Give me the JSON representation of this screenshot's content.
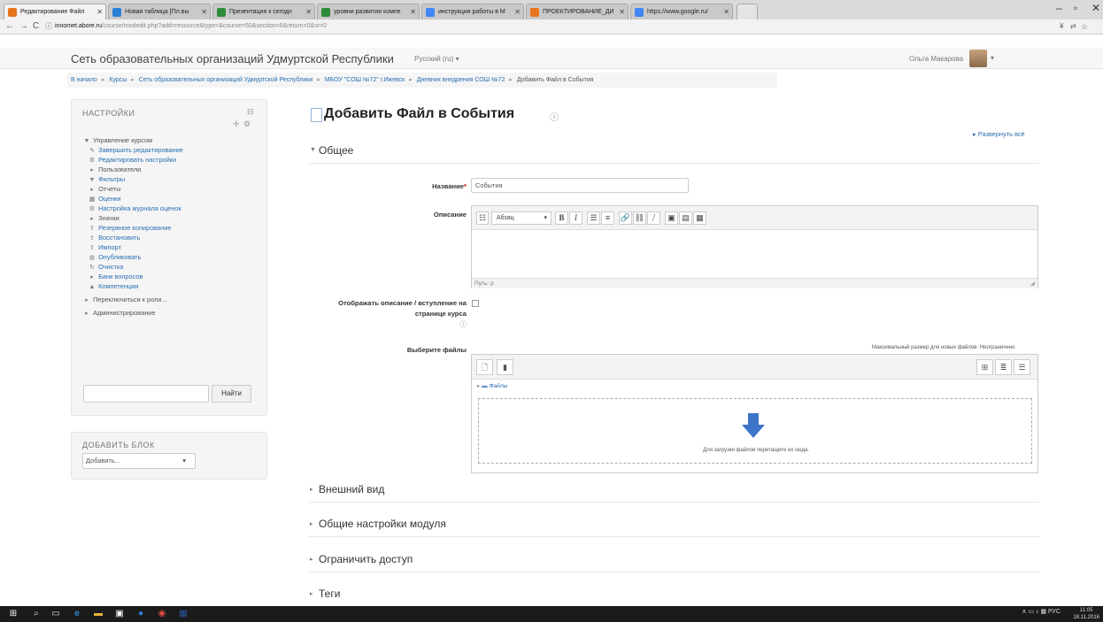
{
  "browser": {
    "tabs": [
      {
        "label": "Редактирование Файл",
        "active": true,
        "icon": "moodle-icon",
        "color": "#e8741c"
      },
      {
        "label": "Новая таблица [Пл.вы",
        "icon": "sheets-icon",
        "color": "#2a7fd4"
      },
      {
        "label": "Презентация к сегодн",
        "icon": "slides-icon",
        "color": "#2e8b3a"
      },
      {
        "label": "уровни развития компе",
        "icon": "sheets-icon",
        "color": "#2e8b3a"
      },
      {
        "label": "инструкция работы в М",
        "icon": "google-icon",
        "color": "#4285f4"
      },
      {
        "label": "ПРОЕКТИРОВАНИЕ_ДИ",
        "icon": "moodle-icon",
        "color": "#e8741c"
      },
      {
        "label": "https://www.google.ru/",
        "icon": "google-icon",
        "color": "#4285f4"
      }
    ],
    "url_host": "innomet.abore.ru",
    "url_path": "/course/modedit.php?add=resource&type=&course=50&section=6&return=0&sr=0",
    "window_controls": [
      "–",
      "▫",
      "✕"
    ]
  },
  "header": {
    "site_name": "Сеть образовательных организаций Удмуртской Республики",
    "language": "Русский (ru) ▾",
    "user_name": "Ольга Макарова",
    "user_caret": "▾"
  },
  "breadcrumb": [
    "В начало",
    "Курсы",
    "Сеть образовательных организаций Удмуртской Республики",
    "МБОУ \"СОШ №72\" г.Ижевск",
    "Дневник внедрения СОШ №72",
    "Добавить Файл в События"
  ],
  "settings_block": {
    "title": "НАСТРОЙКИ",
    "items": [
      {
        "label": "Управление курсом",
        "icon": "caret-down-icon",
        "cls": "root"
      },
      {
        "label": "Завершить редактирование",
        "icon": "pencil-icon",
        "cls": "sub"
      },
      {
        "label": "Редактировать настройки",
        "icon": "gear-icon",
        "cls": "sub"
      },
      {
        "label": "Пользователи",
        "icon": "caret-right-icon",
        "cls": "sub gray"
      },
      {
        "label": "Фильтры",
        "icon": "filter-icon",
        "cls": "sub"
      },
      {
        "label": "Отчеты",
        "icon": "caret-right-icon",
        "cls": "sub gray"
      },
      {
        "label": "Оценки",
        "icon": "grades-icon",
        "cls": "sub"
      },
      {
        "label": "Настройка журнала оценок",
        "icon": "gear-icon",
        "cls": "sub"
      },
      {
        "label": "Значки",
        "icon": "caret-right-icon",
        "cls": "sub gray"
      },
      {
        "label": "Резервное копирование",
        "icon": "upload-icon",
        "cls": "sub"
      },
      {
        "label": "Восстановить",
        "icon": "upload-icon",
        "cls": "sub"
      },
      {
        "label": "Импорт",
        "icon": "upload-icon",
        "cls": "sub"
      },
      {
        "label": "Опубликовать",
        "icon": "globe-icon",
        "cls": "sub"
      },
      {
        "label": "Очистка",
        "icon": "reset-icon",
        "cls": "sub"
      },
      {
        "label": "Банк вопросов",
        "icon": "caret-right-icon",
        "cls": "sub"
      },
      {
        "label": "Компетенции",
        "icon": "competency-icon",
        "cls": "sub"
      },
      {
        "label": "",
        "icon": "",
        "cls": "hr"
      },
      {
        "label": "Переключиться к роли...",
        "icon": "caret-right-icon",
        "cls": "root"
      },
      {
        "label": "",
        "icon": "",
        "cls": "hr"
      },
      {
        "label": "Администрирование",
        "icon": "caret-right-icon",
        "cls": "root"
      }
    ],
    "search_button": "Найти"
  },
  "add_block": {
    "title": "ДОБАВИТЬ БЛОК",
    "select_value": "Добавить...",
    "select_caret": "▾"
  },
  "main": {
    "page_title": "Добавить Файл в События",
    "expand_all": "▸ Развернуть всё",
    "section_general": "Общее",
    "name_label": "Название",
    "name_required": "*",
    "name_value": "События",
    "description_label": "Описание",
    "editor_format": "Абзац",
    "editor_buttons": [
      "B",
      "I",
      "☰",
      "≡",
      "🔗",
      "⛓",
      "⧸",
      "▣",
      "▤",
      "▦"
    ],
    "editor_path": "Путь: p",
    "show_description_label": "Отображать описание / вступление на странице курса",
    "select_files_label": "Выберите файлы",
    "max_size": "Максимальный размер для новых файлов: Неограничено",
    "folder_label": "Файлы",
    "drop_text": "Для загрузки файлов перетащите их сюда.",
    "sections": [
      "Внешний вид",
      "Общие настройки модуля",
      "Ограничить доступ",
      "Теги"
    ]
  },
  "taskbar": {
    "tray": "∧ ▭ ♪ ▦ РУС",
    "time": "11:05",
    "date": "18.11.2016"
  }
}
